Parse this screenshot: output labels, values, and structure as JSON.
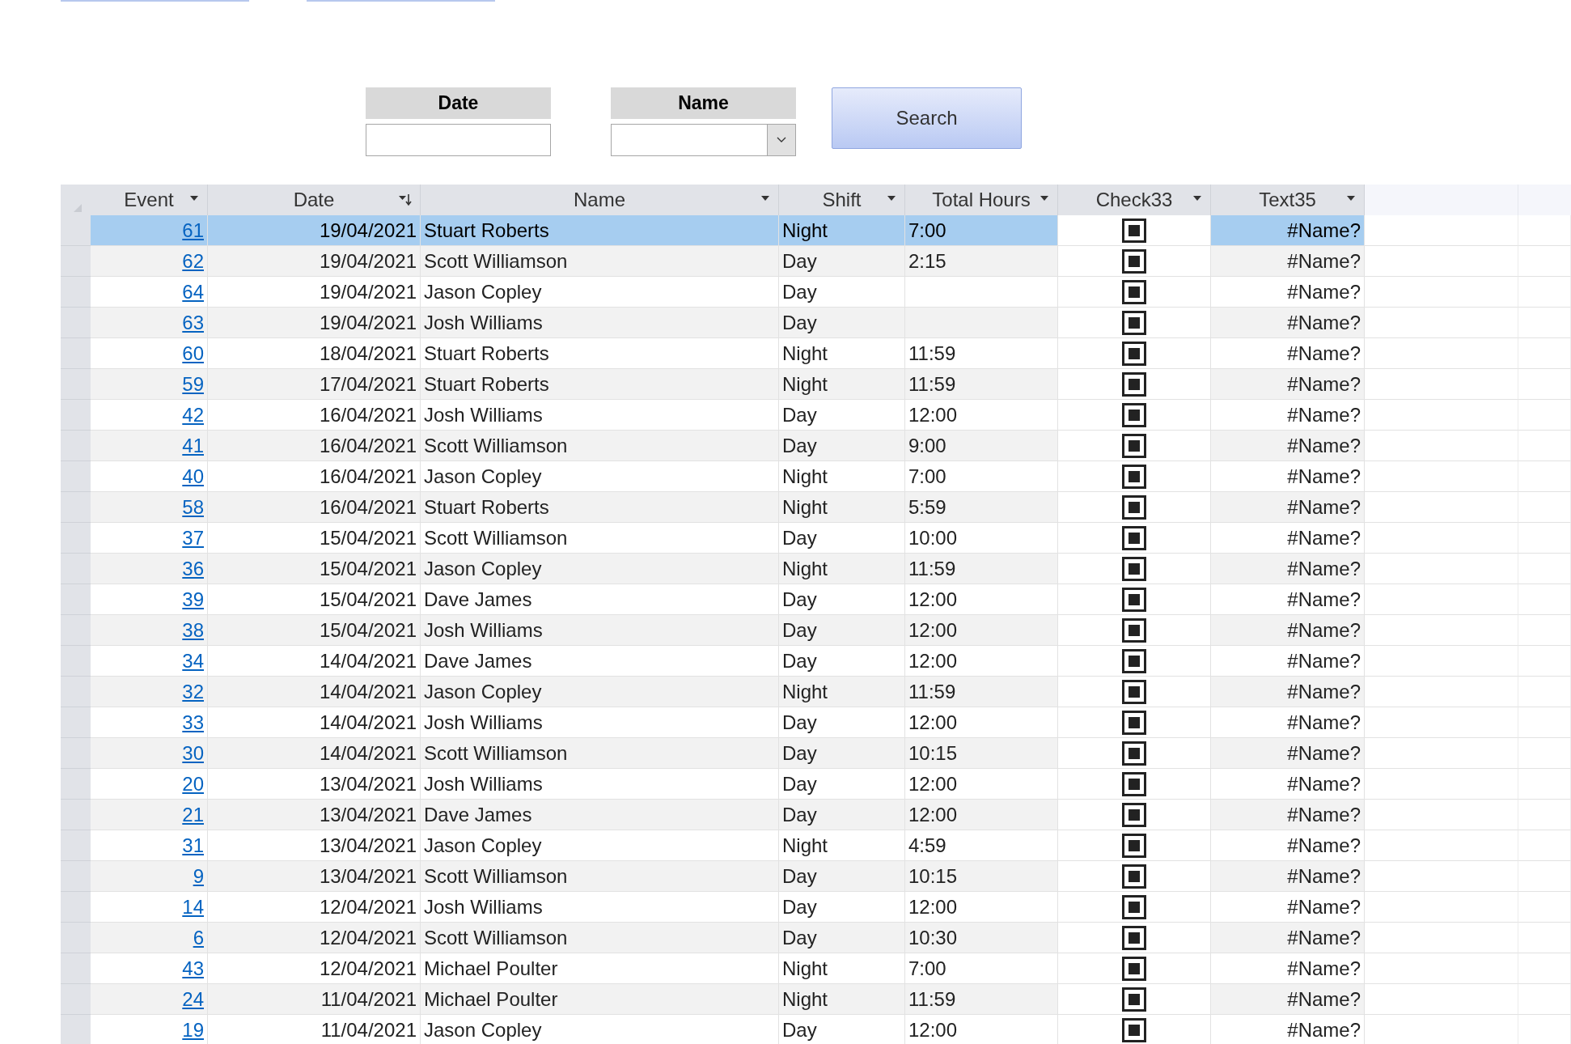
{
  "top_buttons": [
    {
      "kind": "button"
    },
    {
      "kind": "button"
    }
  ],
  "filters": {
    "date_label": "Date",
    "name_label": "Name",
    "search_button": "Search"
  },
  "table": {
    "columns": [
      {
        "label": "Event",
        "sorted": false
      },
      {
        "label": "Date",
        "sorted": true
      },
      {
        "label": "Name",
        "sorted": false
      },
      {
        "label": "Shift",
        "sorted": false
      },
      {
        "label": "Total Hours",
        "sorted": false
      },
      {
        "label": "Check33",
        "sorted": false
      },
      {
        "label": "Text35",
        "sorted": false
      }
    ],
    "rows": [
      {
        "event": "61",
        "date": "19/04/2021",
        "name": "Stuart Roberts",
        "shift": "Night",
        "total_hours": "7:00",
        "check33": true,
        "text35": "#Name?",
        "selected": true
      },
      {
        "event": "62",
        "date": "19/04/2021",
        "name": "Scott Williamson",
        "shift": "Day",
        "total_hours": "2:15",
        "check33": true,
        "text35": "#Name?",
        "selected": false
      },
      {
        "event": "64",
        "date": "19/04/2021",
        "name": "Jason Copley",
        "shift": "Day",
        "check33": true,
        "text35": "#Name?",
        "selected": false
      },
      {
        "event": "63",
        "date": "19/04/2021",
        "name": "Josh Williams",
        "shift": "Day",
        "check33": true,
        "text35": "#Name?",
        "selected": false
      },
      {
        "event": "60",
        "date": "18/04/2021",
        "name": "Stuart Roberts",
        "shift": "Night",
        "total_hours": "11:59",
        "check33": true,
        "text35": "#Name?",
        "selected": false
      },
      {
        "event": "59",
        "date": "17/04/2021",
        "name": "Stuart Roberts",
        "shift": "Night",
        "total_hours": "11:59",
        "check33": true,
        "text35": "#Name?",
        "selected": false
      },
      {
        "event": "42",
        "date": "16/04/2021",
        "name": "Josh Williams",
        "shift": "Day",
        "total_hours": "12:00",
        "check33": true,
        "text35": "#Name?",
        "selected": false
      },
      {
        "event": "41",
        "date": "16/04/2021",
        "name": "Scott Williamson",
        "shift": "Day",
        "total_hours": "9:00",
        "check33": true,
        "text35": "#Name?",
        "selected": false
      },
      {
        "event": "40",
        "date": "16/04/2021",
        "name": "Jason Copley",
        "shift": "Night",
        "total_hours": "7:00",
        "check33": true,
        "text35": "#Name?",
        "selected": false
      },
      {
        "event": "58",
        "date": "16/04/2021",
        "name": "Stuart Roberts",
        "shift": "Night",
        "total_hours": "5:59",
        "check33": true,
        "text35": "#Name?",
        "selected": false
      },
      {
        "event": "37",
        "date": "15/04/2021",
        "name": "Scott Williamson",
        "shift": "Day",
        "total_hours": "10:00",
        "check33": true,
        "text35": "#Name?",
        "selected": false
      },
      {
        "event": "36",
        "date": "15/04/2021",
        "name": "Jason Copley",
        "shift": "Night",
        "total_hours": "11:59",
        "check33": true,
        "text35": "#Name?",
        "selected": false
      },
      {
        "event": "39",
        "date": "15/04/2021",
        "name": "Dave James",
        "shift": "Day",
        "total_hours": "12:00",
        "check33": true,
        "text35": "#Name?",
        "selected": false
      },
      {
        "event": "38",
        "date": "15/04/2021",
        "name": "Josh Williams",
        "shift": "Day",
        "total_hours": "12:00",
        "check33": true,
        "text35": "#Name?",
        "selected": false
      },
      {
        "event": "34",
        "date": "14/04/2021",
        "name": "Dave James",
        "shift": "Day",
        "total_hours": "12:00",
        "check33": true,
        "text35": "#Name?",
        "selected": false
      },
      {
        "event": "32",
        "date": "14/04/2021",
        "name": "Jason Copley",
        "shift": "Night",
        "total_hours": "11:59",
        "check33": true,
        "text35": "#Name?",
        "selected": false
      },
      {
        "event": "33",
        "date": "14/04/2021",
        "name": "Josh Williams",
        "shift": "Day",
        "total_hours": "12:00",
        "check33": true,
        "text35": "#Name?",
        "selected": false
      },
      {
        "event": "30",
        "date": "14/04/2021",
        "name": "Scott Williamson",
        "shift": "Day",
        "total_hours": "10:15",
        "check33": true,
        "text35": "#Name?",
        "selected": false
      },
      {
        "event": "20",
        "date": "13/04/2021",
        "name": "Josh Williams",
        "shift": "Day",
        "total_hours": "12:00",
        "check33": true,
        "text35": "#Name?",
        "selected": false
      },
      {
        "event": "21",
        "date": "13/04/2021",
        "name": "Dave James",
        "shift": "Day",
        "total_hours": "12:00",
        "check33": true,
        "text35": "#Name?",
        "selected": false
      },
      {
        "event": "31",
        "date": "13/04/2021",
        "name": "Jason Copley",
        "shift": "Night",
        "total_hours": "4:59",
        "check33": true,
        "text35": "#Name?",
        "selected": false
      },
      {
        "event": "9",
        "date": "13/04/2021",
        "name": "Scott Williamson",
        "shift": "Day",
        "total_hours": "10:15",
        "check33": true,
        "text35": "#Name?",
        "selected": false
      },
      {
        "event": "14",
        "date": "12/04/2021",
        "name": "Josh Williams",
        "shift": "Day",
        "total_hours": "12:00",
        "check33": true,
        "text35": "#Name?",
        "selected": false
      },
      {
        "event": "6",
        "date": "12/04/2021",
        "name": "Scott Williamson",
        "shift": "Day",
        "total_hours": "10:30",
        "check33": true,
        "text35": "#Name?",
        "selected": false
      },
      {
        "event": "43",
        "date": "12/04/2021",
        "name": "Michael Poulter",
        "shift": "Night",
        "total_hours": "7:00",
        "check33": true,
        "text35": "#Name?",
        "selected": false
      },
      {
        "event": "24",
        "date": "11/04/2021",
        "name": "Michael Poulter",
        "shift": "Night",
        "total_hours": "11:59",
        "check33": true,
        "text35": "#Name?",
        "selected": false
      },
      {
        "event": "19",
        "date": "11/04/2021",
        "name": "Jason Copley",
        "shift": "Day",
        "total_hours": "12:00",
        "check33": true,
        "text35": "#Name?",
        "selected": false
      }
    ]
  }
}
